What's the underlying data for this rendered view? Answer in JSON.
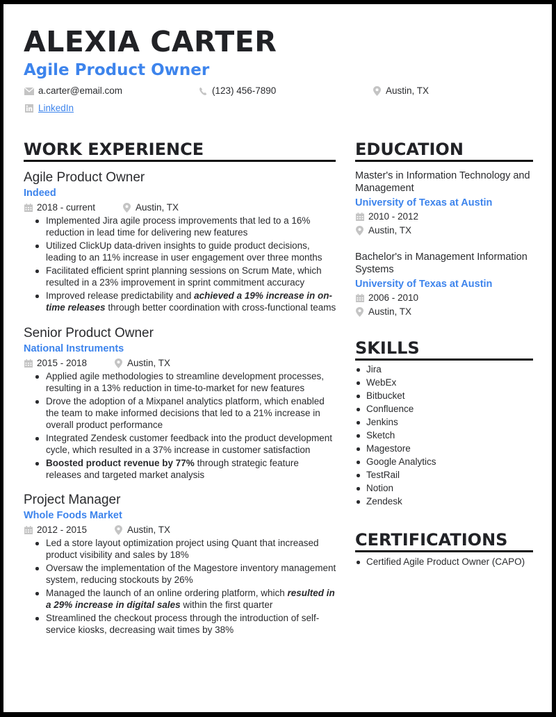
{
  "header": {
    "name": "ALEXIA CARTER",
    "title": "Agile Product Owner",
    "email": "a.carter@email.com",
    "phone": "(123) 456-7890",
    "location": "Austin, TX",
    "linkedin": "LinkedIn"
  },
  "colors": {
    "accent": "#3d84ec",
    "text": "#2a2b2e",
    "icon": "#c4c4c4",
    "frame": "#000000"
  },
  "work": {
    "heading": "WORK EXPERIENCE",
    "jobs": [
      {
        "title": "Agile Product Owner",
        "company": "Indeed",
        "dates": "2018 - current",
        "location": "Austin, TX",
        "bullets": [
          {
            "parts": [
              {
                "text": "Implemented Jira agile process improvements that led to a 16% reduction in lead time for delivering new features"
              }
            ]
          },
          {
            "parts": [
              {
                "text": "Utilized ClickUp data-driven insights to guide product decisions, leading to an 11% increase in user engagement over three months"
              }
            ]
          },
          {
            "parts": [
              {
                "text": "Facilitated efficient sprint planning sessions on Scrum Mate, which resulted in a 23% improvement in sprint commitment accuracy"
              }
            ]
          },
          {
            "parts": [
              {
                "text": "Improved release predictability and "
              },
              {
                "text": "achieved a 19% increase in on-time releases",
                "style": "bi"
              },
              {
                "text": " through better coordination with cross-functional teams"
              }
            ]
          }
        ]
      },
      {
        "title": "Senior Product Owner",
        "company": "National Instruments",
        "dates": "2015 - 2018",
        "location": "Austin, TX",
        "bullets": [
          {
            "parts": [
              {
                "text": "Applied agile methodologies to streamline development processes, resulting in a 13% reduction in time-to-market for new features"
              }
            ]
          },
          {
            "parts": [
              {
                "text": "Drove the adoption of a Mixpanel analytics platform, which enabled the team to make informed decisions that led to a 21% increase in overall product performance"
              }
            ]
          },
          {
            "parts": [
              {
                "text": "Integrated Zendesk customer feedback into the product development cycle, which resulted in a 37% increase in customer satisfaction"
              }
            ]
          },
          {
            "parts": [
              {
                "text": "Boosted product revenue by 77%",
                "style": "b"
              },
              {
                "text": " through strategic feature releases and targeted market analysis"
              }
            ]
          }
        ]
      },
      {
        "title": "Project Manager",
        "company": "Whole Foods Market",
        "dates": "2012 - 2015",
        "location": "Austin, TX",
        "bullets": [
          {
            "parts": [
              {
                "text": "Led a store layout optimization project using Quant that increased product visibility and sales by 18%"
              }
            ]
          },
          {
            "parts": [
              {
                "text": "Oversaw the implementation of the Magestore inventory management system, reducing stockouts by 26%"
              }
            ]
          },
          {
            "parts": [
              {
                "text": "Managed the launch of an online ordering platform, which "
              },
              {
                "text": "resulted in a 29% increase in digital sales",
                "style": "bi"
              },
              {
                "text": " within the first quarter"
              }
            ]
          },
          {
            "parts": [
              {
                "text": "Streamlined the checkout process through the introduction of self-service kiosks, decreasing wait times by 38%"
              }
            ]
          }
        ]
      }
    ]
  },
  "education": {
    "heading": "EDUCATION",
    "items": [
      {
        "degree": "Master's in Information Technology and Management",
        "school": "University of Texas at Austin",
        "dates": "2010 - 2012",
        "location": "Austin, TX"
      },
      {
        "degree": "Bachelor's in Management Information Systems",
        "school": "University of Texas at Austin",
        "dates": "2006 - 2010",
        "location": "Austin, TX"
      }
    ]
  },
  "skills": {
    "heading": "SKILLS",
    "items": [
      "Jira",
      "WebEx",
      "Bitbucket",
      "Confluence",
      "Jenkins",
      "Sketch",
      "Magestore",
      "Google Analytics",
      "TestRail",
      "Notion",
      "Zendesk"
    ]
  },
  "certifications": {
    "heading": "CERTIFICATIONS",
    "items": [
      "Certified Agile Product Owner (CAPO)"
    ]
  }
}
